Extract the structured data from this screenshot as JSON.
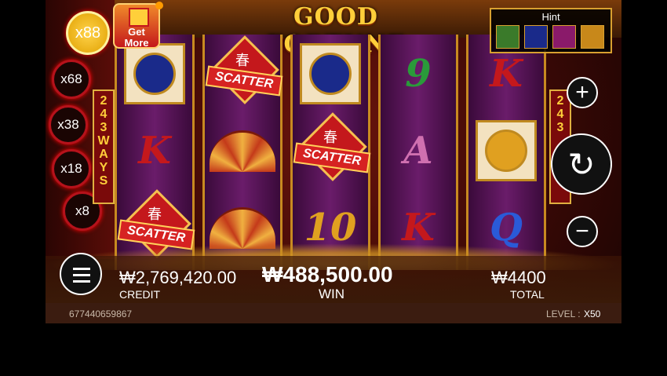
{
  "title": "GOOD FORTUNE",
  "get_more": "Get More",
  "hint": {
    "label": "Hint",
    "icons": [
      "gold-ingot-icon",
      "koi-fish-icon",
      "scatter-icon",
      "gold-coin-icon"
    ]
  },
  "multipliers": [
    {
      "label": "x88",
      "active": true
    },
    {
      "label": "x68"
    },
    {
      "label": "x38"
    },
    {
      "label": "x18"
    },
    {
      "label": "x8"
    }
  ],
  "ways_text": [
    "2",
    "4",
    "3",
    "W",
    "A",
    "Y",
    "S"
  ],
  "ways_right": [
    "2",
    "4",
    "3"
  ],
  "reels": [
    [
      {
        "type": "tile",
        "icon": "koi-fish-icon"
      },
      {
        "type": "letter",
        "text": "K",
        "color": "#c4181c"
      },
      {
        "type": "scatter",
        "text": "SCATTER",
        "char": "春"
      }
    ],
    [
      {
        "type": "scatter",
        "text": "SCATTER",
        "char": "春"
      },
      {
        "type": "fan",
        "icon": "fan-icon"
      },
      {
        "type": "fan",
        "icon": "fan-icon"
      }
    ],
    [
      {
        "type": "tile",
        "icon": "koi-fish-icon"
      },
      {
        "type": "scatter",
        "text": "SCATTER",
        "char": "春"
      },
      {
        "type": "letter",
        "text": "10",
        "color": "#e0a020"
      }
    ],
    [
      {
        "type": "letter",
        "text": "9",
        "color": "#2a9a3a"
      },
      {
        "type": "letter",
        "text": "A",
        "color": "#d070b0"
      },
      {
        "type": "letter",
        "text": "K",
        "color": "#c4181c"
      }
    ],
    [
      {
        "type": "letter",
        "text": "K",
        "color": "#c4181c"
      },
      {
        "type": "tile",
        "icon": "gold-coin-icon"
      },
      {
        "type": "letter",
        "text": "Q",
        "color": "#2a5ad8"
      }
    ]
  ],
  "credit": {
    "value": "₩2,769,420.00",
    "label": "CREDIT"
  },
  "win": {
    "value": "₩488,500.00",
    "label": "WIN"
  },
  "total": {
    "value": "₩4400",
    "label": "TOTAL"
  },
  "footer": {
    "id": "677440659867",
    "level_label": "LEVEL :",
    "level_value": "X50"
  },
  "colors": {
    "accent": "#ffcf3a",
    "frame": "#c88a20",
    "red": "#b5121b"
  }
}
